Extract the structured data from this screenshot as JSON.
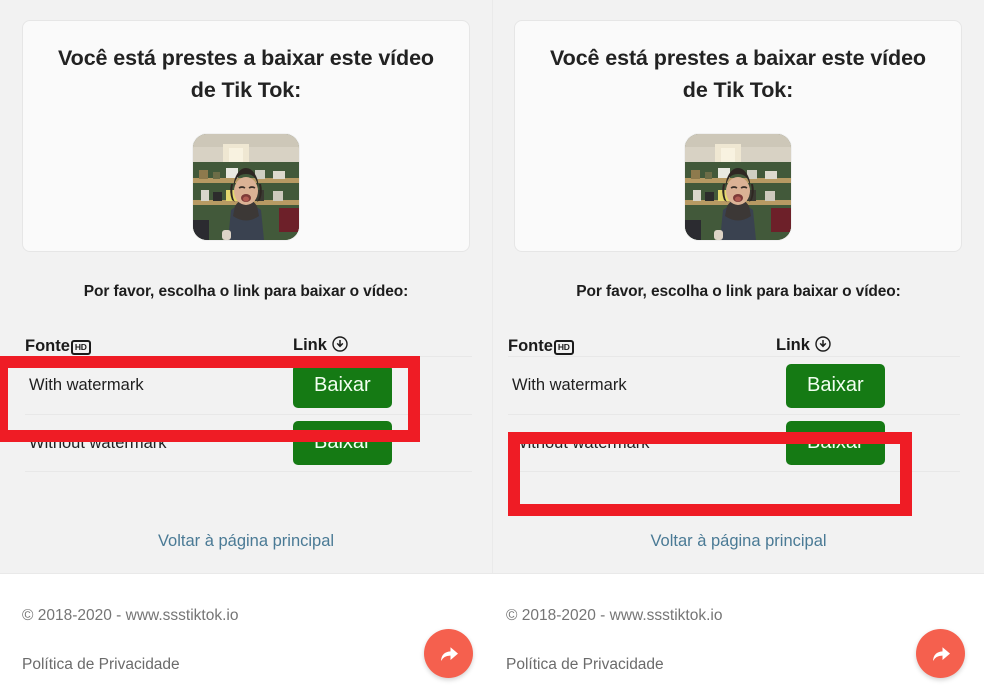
{
  "page": {
    "heading_line1": "Você está prestes a baixar este",
    "heading_line2": "vídeo de Tik Tok:",
    "choose_prompt": "Por favor, escolha o link para baixar o vídeo:",
    "back_link": "Voltar à página principal"
  },
  "table": {
    "header_source": "Fonte",
    "header_source_badge": "HD",
    "header_link": "Link",
    "header_link_icon": "download-circle-icon",
    "rows": [
      {
        "source": "With watermark",
        "button": "Baixar"
      },
      {
        "source": "Without watermark",
        "button": "Baixar"
      }
    ]
  },
  "footer": {
    "copyright": "© 2018-2020 - www.ssstiktok.io",
    "privacy": "Política de Privacidade",
    "share_icon": "share-arrow-icon"
  },
  "annotations": {
    "left_highlight_target": "With watermark",
    "right_highlight_target": "Without watermark",
    "highlight_color": "#ef1c25"
  },
  "colors": {
    "download_button": "#157a14",
    "link_text": "#4a7a95",
    "share_fab": "#f5604e",
    "page_background": "#f2f2f2",
    "footer_background": "#ffffff"
  },
  "thumbnail": {
    "alt": "video-thumbnail-person-in-front-of-green-shelves"
  }
}
